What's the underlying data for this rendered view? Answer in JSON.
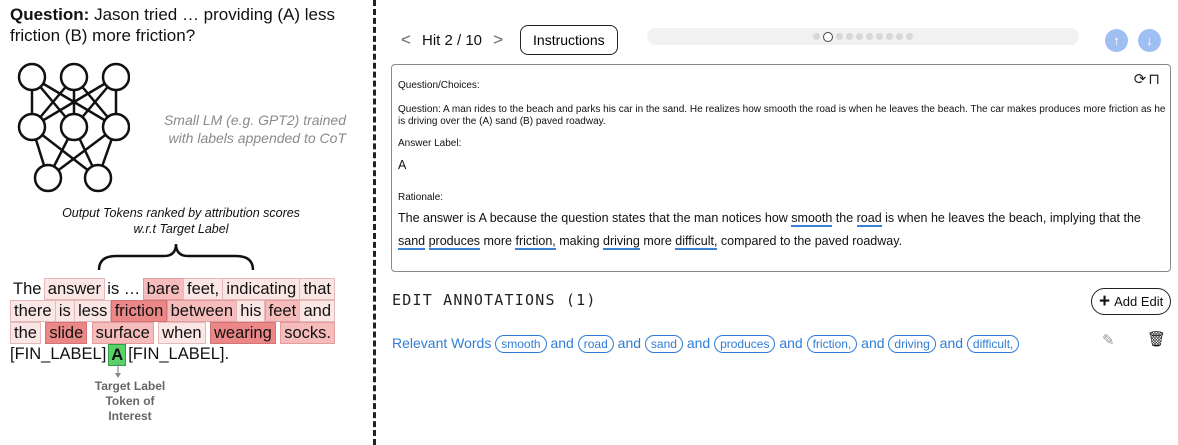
{
  "figure": {
    "question_label": "Question:",
    "question_text": " Jason tried … providing (A) less friction (B) more friction?",
    "nn_caption_1": "Small LM (e.g. GPT2) trained",
    "nn_caption_2": "with labels appended to CoT",
    "output_caption_1": "Output Tokens ranked by attribution scores",
    "output_caption_2": "w.r.t Target Label",
    "token_lines": [
      [
        {
          "t": "The",
          "h": 0
        },
        {
          "t": "answer",
          "h": 1
        },
        {
          "t": "is …",
          "h": 0
        },
        {
          "t": "bare",
          "h": 2
        },
        {
          "t": "feet,",
          "h": 1
        },
        {
          "t": "indicating",
          "h": 1
        },
        {
          "t": "that",
          "h": 1
        }
      ],
      [
        {
          "t": "there",
          "h": 1
        },
        {
          "t": "is",
          "h": 1
        },
        {
          "t": "less",
          "h": 1
        },
        {
          "t": "friction",
          "h": 3
        },
        {
          "t": "between",
          "h": 2
        },
        {
          "t": "his",
          "h": 1
        },
        {
          "t": "feet",
          "h": 2
        },
        {
          "t": "and",
          "h": 1
        }
      ],
      [
        {
          "t": "the",
          "h": 1
        },
        {
          "t": "slide",
          "h": 3
        },
        {
          "t": "surface",
          "h": 2
        },
        {
          "t": "when",
          "h": 1
        },
        {
          "t": "wearing",
          "h": 3
        },
        {
          "t": "socks.",
          "h": 2
        }
      ]
    ],
    "fin_label": "[FIN_LABEL]",
    "target_token": "A",
    "fin_label_end": "[FIN_LABEL].",
    "target_caption_1": "Target Label",
    "target_caption_2": "Token of",
    "target_caption_3": "Interest"
  },
  "ui": {
    "prev_arrow": "<",
    "next_arrow": ">",
    "hit_label": "Hit 2 / 10",
    "instructions_label": "Instructions",
    "progress": {
      "total": 10,
      "current": 2
    },
    "question_choices_label": "Question/Choices:",
    "question_text": "Question: A man rides to the beach and parks his car in the sand. He realizes how smooth the road is when he leaves the beach. The car makes produces more friction as he is driving over the (A) sand (B) paved roadway.",
    "answer_label_title": "Answer Label:",
    "answer_value": "A",
    "rationale_title": "Rationale:",
    "rationale_parts": [
      {
        "t": "The answer is A because the question states that the man notices how ",
        "u": false
      },
      {
        "t": "smooth",
        "u": true
      },
      {
        "t": " the ",
        "u": false
      },
      {
        "t": "road",
        "u": true
      },
      {
        "t": " is when he leaves the beach, implying that the ",
        "u": false
      },
      {
        "t": "sand",
        "u": true
      },
      {
        "t": " ",
        "u": false
      },
      {
        "t": "produces",
        "u": true
      },
      {
        "t": " more ",
        "u": false
      },
      {
        "t": "friction,",
        "u": true
      },
      {
        "t": " making ",
        "u": false
      },
      {
        "t": "driving",
        "u": true
      },
      {
        "t": " more ",
        "u": false
      },
      {
        "t": "difficult,",
        "u": true
      },
      {
        "t": " compared to the paved roadway.",
        "u": false
      }
    ],
    "edit_title": "EDIT ANNOTATIONS (1)",
    "add_edit_label": "Add Edit",
    "relevant_words_label": "Relevant Words",
    "and_word": "and",
    "relevant_words": [
      "smooth",
      "road",
      "sand",
      "produces",
      "friction,",
      "driving",
      "difficult,"
    ],
    "accent_color": "#2f7cd6"
  }
}
